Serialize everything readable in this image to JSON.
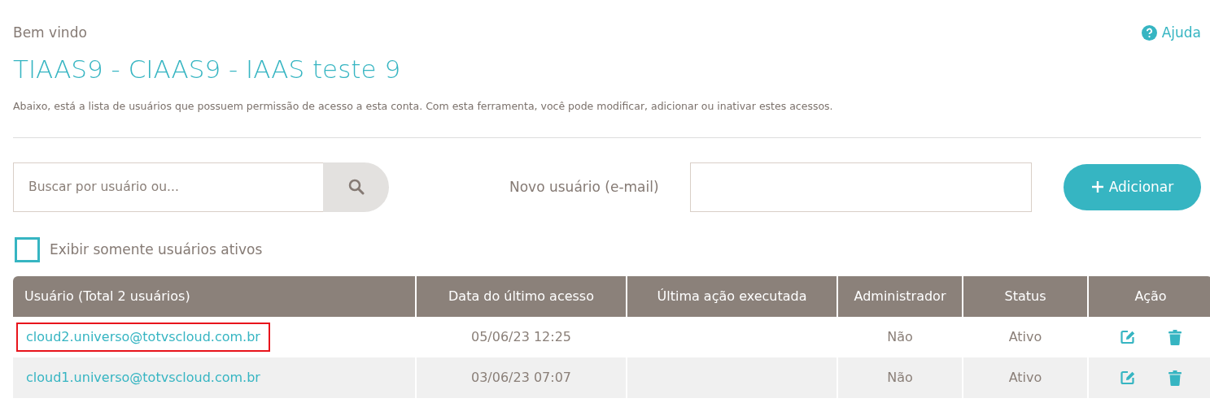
{
  "greeting": "Bem vindo",
  "help": {
    "label": "Ajuda"
  },
  "title": "TIAAS9 - CIAAS9 - IAAS teste 9",
  "description": "Abaixo, está a lista de usuários que possuem permissão de acesso a esta conta. Com esta ferramenta, você pode modificar, adicionar ou inativar estes acessos.",
  "search": {
    "placeholder": "Buscar por usuário ou..."
  },
  "new_user": {
    "label": "Novo usuário (e-mail)"
  },
  "add_button": {
    "label": "Adicionar"
  },
  "active_only": {
    "label": "Exibir somente usuários ativos",
    "checked": false
  },
  "table": {
    "columns": [
      "Usuário (Total 2 usuários)",
      "Data do último acesso",
      "Última ação executada",
      "Administrador",
      "Status",
      "Ação"
    ],
    "rows": [
      {
        "user": "cloud2.universo@totvscloud.com.br",
        "last_access": "05/06/23 12:25",
        "admin": "Não",
        "status": "Ativo",
        "highlighted": true
      },
      {
        "user": "cloud1.universo@totvscloud.com.br",
        "last_access": "03/06/23 07:07",
        "admin": "Não",
        "status": "Ativo",
        "highlighted": false
      }
    ]
  }
}
